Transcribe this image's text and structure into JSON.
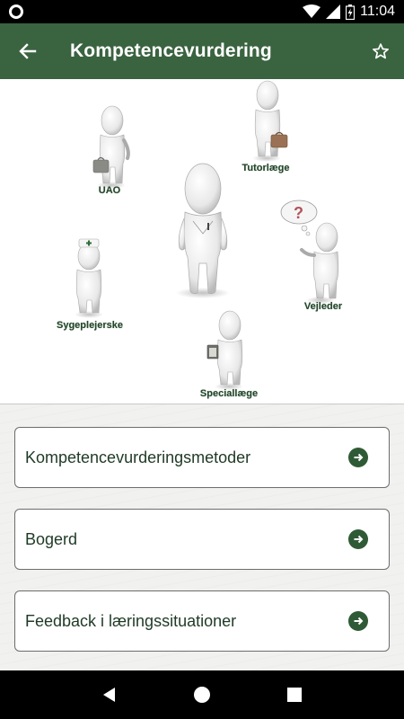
{
  "status_bar": {
    "time": "11:04"
  },
  "app_bar": {
    "title": "Kompetencevurdering"
  },
  "roles": [
    {
      "label": "UAO"
    },
    {
      "label": "Tutorlæge"
    },
    {
      "label": "Vejleder"
    },
    {
      "label": "Sygeplejerske"
    },
    {
      "label": "Speciallæge"
    }
  ],
  "menu": {
    "items": [
      {
        "label": "Kompetencevurderingsmetoder"
      },
      {
        "label": "Bogerd"
      },
      {
        "label": "Feedback i læringssituationer"
      }
    ]
  },
  "colors": {
    "app_bar": "#3a6340",
    "accent": "#2f5a36",
    "label_text": "#23432a"
  },
  "icons": [
    "back-arrow-icon",
    "star-outline-icon",
    "arrow-right-circle-icon"
  ]
}
